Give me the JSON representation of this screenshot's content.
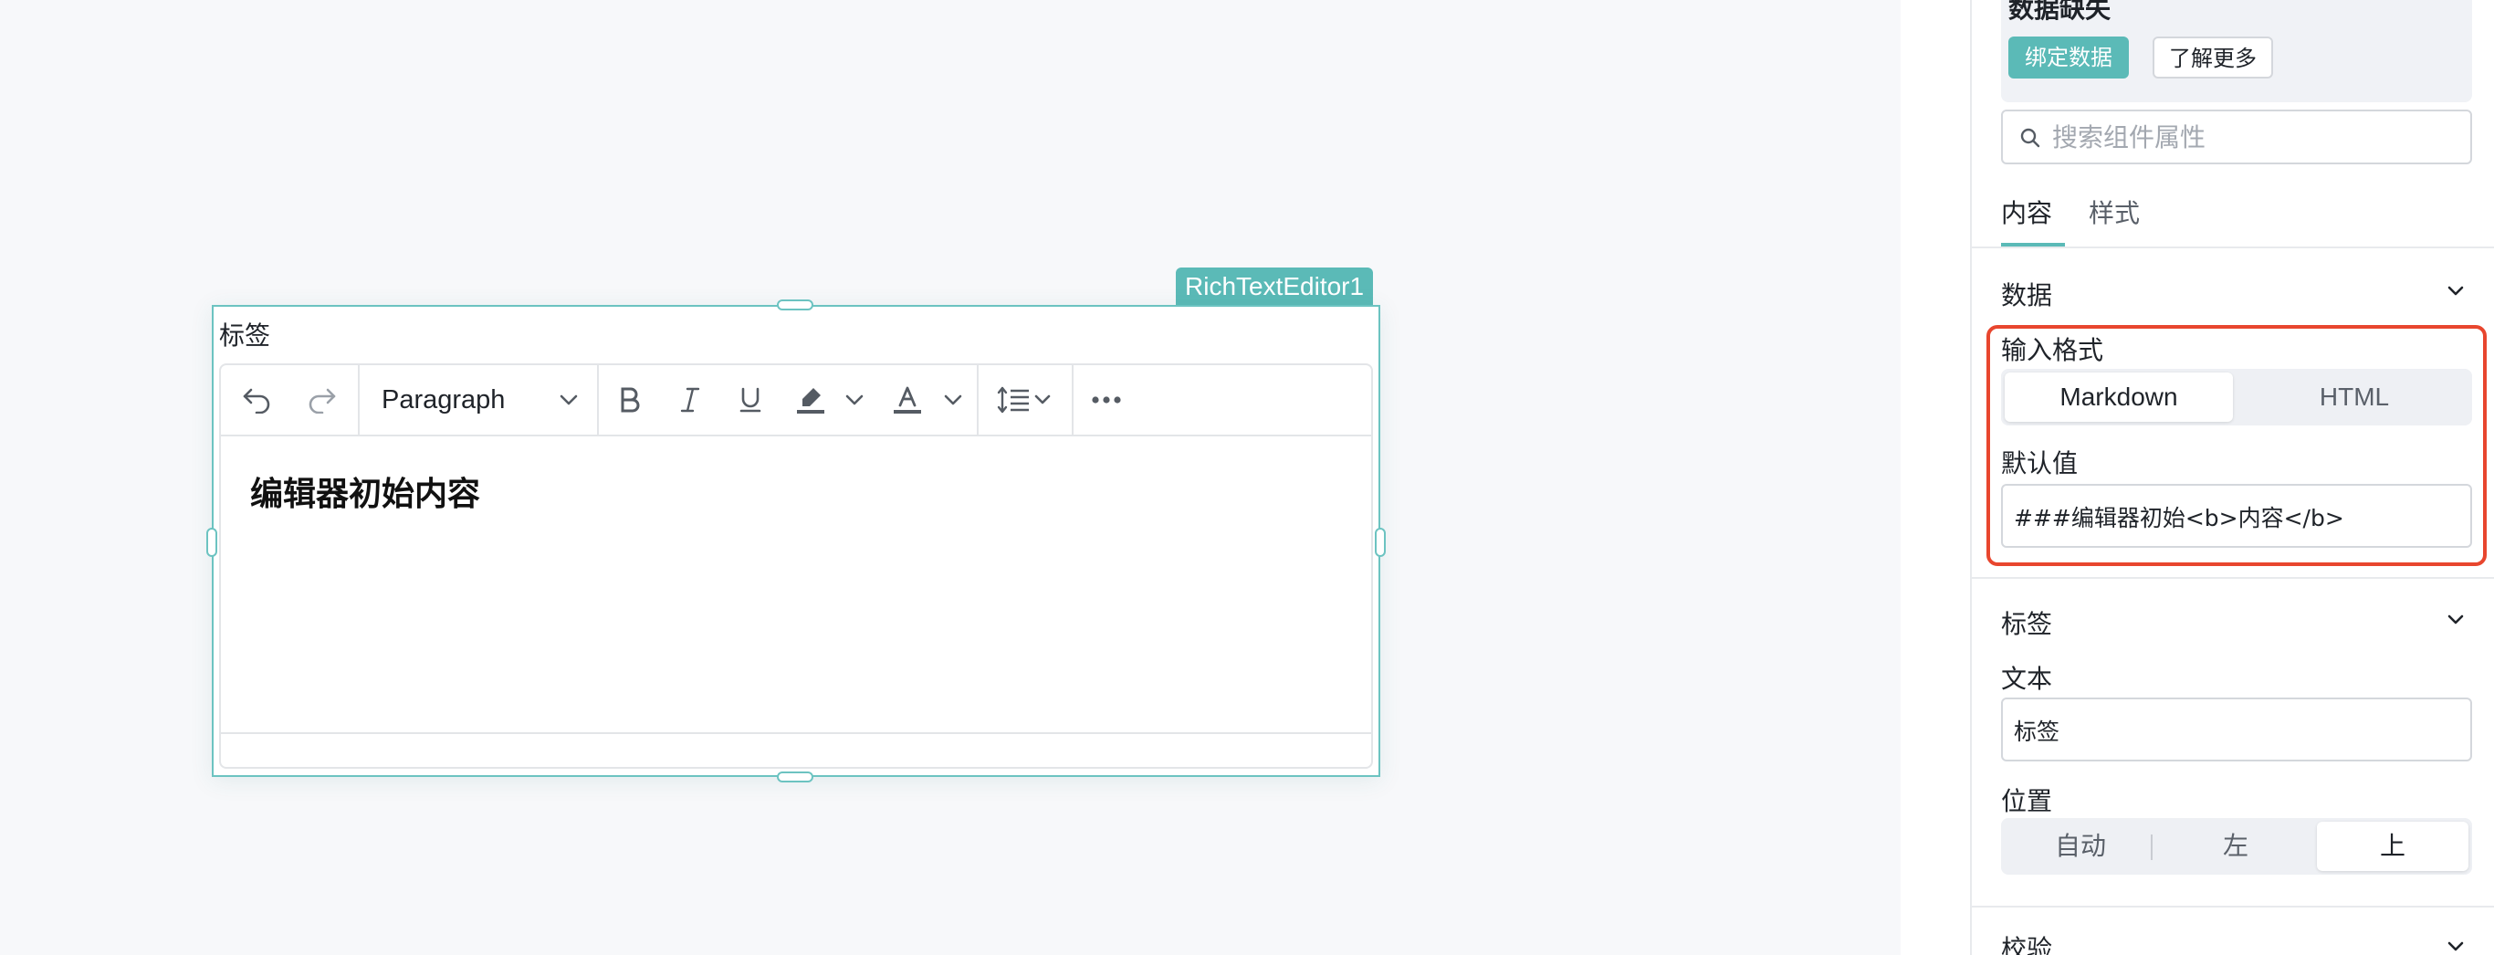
{
  "canvas": {
    "component_id": "RichTextEditor1",
    "field_label": "标签",
    "toolbar": {
      "block_format": "Paragraph",
      "buttons": [
        "undo-icon",
        "redo-icon",
        "bold-icon",
        "italic-icon",
        "underline-icon",
        "highlight-icon",
        "font-color-icon",
        "line-height-icon",
        "more-icon"
      ]
    },
    "editor_content": "编辑器初始内容"
  },
  "panel": {
    "data_missing": {
      "title": "数据缺失",
      "bind_button": "绑定数据",
      "learn_button": "了解更多"
    },
    "search": {
      "placeholder": "搜索组件属性",
      "value": ""
    },
    "tabs": [
      {
        "label": "内容",
        "active": true
      },
      {
        "label": "样式",
        "active": false
      }
    ],
    "sections": {
      "data": {
        "title": "数据",
        "input_format_label": "输入格式",
        "input_format_options": [
          "Markdown",
          "HTML"
        ],
        "input_format_selected": "Markdown",
        "default_value_label": "默认值",
        "default_value": "###编辑器初始<b>内容</b>"
      },
      "label": {
        "title": "标签",
        "text_label": "文本",
        "text_value": "标签",
        "position_label": "位置",
        "position_options": [
          "自动",
          "左",
          "上"
        ],
        "position_selected": "上"
      },
      "validation": {
        "title": "校验"
      }
    }
  },
  "colors": {
    "accent": "#5bbab7",
    "selection_border": "#6cc3c1",
    "highlight_box": "#e8462e"
  }
}
